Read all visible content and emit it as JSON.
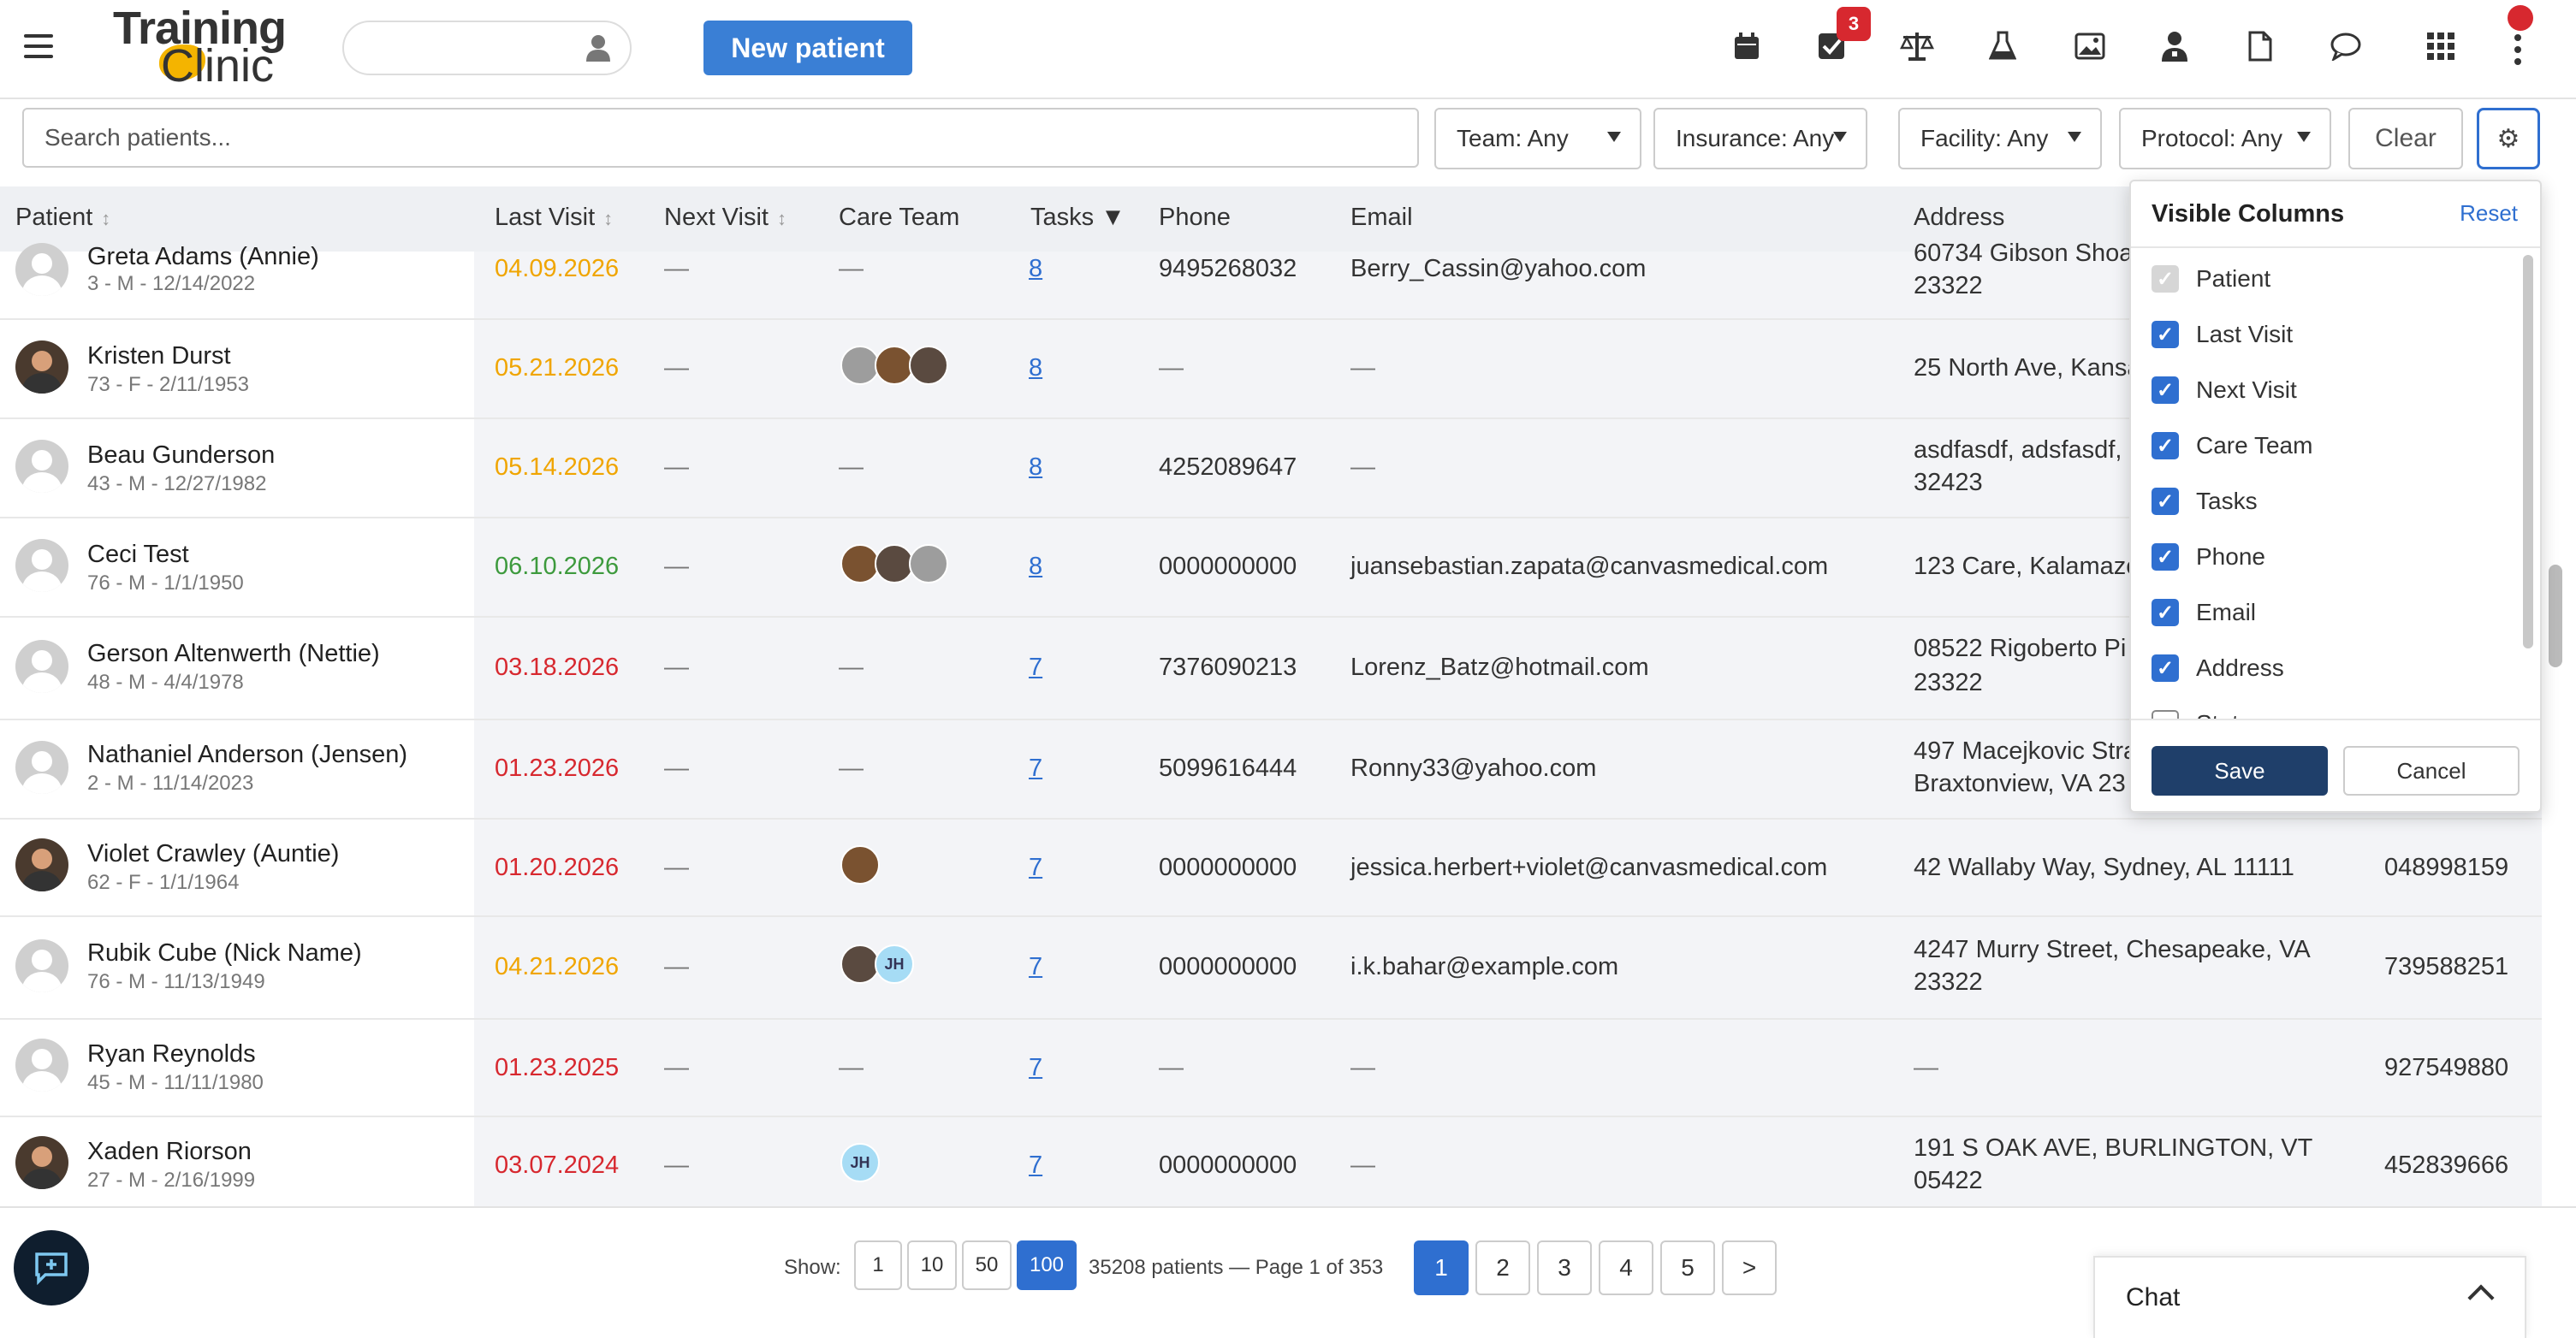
{
  "header": {
    "logo_line1": "Training",
    "logo_line2": "Clinic",
    "new_patient_label": "New patient",
    "tasks_badge": "3",
    "icons": [
      "calendar-icon",
      "tasks-icon",
      "scale-icon",
      "flask-icon",
      "image-icon",
      "doctor-icon",
      "document-icon",
      "chat-bubble-icon",
      "apps-grid-icon",
      "more-vertical-icon"
    ]
  },
  "filters": {
    "search_placeholder": "Search patients...",
    "team": "Team: Any",
    "insurance": "Insurance: Any",
    "facility": "Facility: Any",
    "protocol": "Protocol: Any",
    "clear": "Clear",
    "settings_icon": "⚙"
  },
  "table": {
    "columns": [
      "Patient",
      "Last Visit",
      "Next Visit",
      "Care Team",
      "Tasks ▼",
      "Phone",
      "Email",
      "Address"
    ],
    "rows": [
      {
        "name": "Greta Adams (Annie)",
        "meta": "3 - M - 12/14/2022",
        "last_visit": "04.09.2026",
        "lv_status": "orange",
        "next_visit": "—",
        "care_team_text": "—",
        "tasks": "8",
        "phone": "9495268032",
        "email": "Berry_Cassin@yahoo.com",
        "address": "60734 Gibson Shoa",
        "address2": "23322",
        "id": ""
      },
      {
        "name": "Kristen Durst",
        "meta": "73 - F - 2/11/1953",
        "last_visit": "05.21.2026",
        "lv_status": "orange",
        "next_visit": "—",
        "care_team_text": "",
        "tasks": "8",
        "phone": "—",
        "email": "—",
        "address": "25 North Ave, Kansa",
        "address2": "",
        "id": ""
      },
      {
        "name": "Beau Gunderson",
        "meta": "43 - M - 12/27/1982",
        "last_visit": "05.14.2026",
        "lv_status": "orange",
        "next_visit": "—",
        "care_team_text": "—",
        "tasks": "8",
        "phone": "4252089647",
        "email": "—",
        "address": "asdfasdf, adsfasdf,",
        "address2": "32423",
        "id": ""
      },
      {
        "name": "Ceci Test",
        "meta": "76 - M - 1/1/1950",
        "last_visit": "06.10.2026",
        "lv_status": "green",
        "next_visit": "—",
        "care_team_text": "",
        "tasks": "8",
        "phone": "0000000000",
        "email": "juansebastian.zapata@canvasmedical.com",
        "address": "123 Care, Kalamazo",
        "address2": "",
        "id": ""
      },
      {
        "name": "Gerson Altenwerth (Nettie)",
        "meta": "48 - M - 4/4/1978",
        "last_visit": "03.18.2026",
        "lv_status": "red",
        "next_visit": "—",
        "care_team_text": "—",
        "tasks": "7",
        "phone": "7376090213",
        "email": "Lorenz_Batz@hotmail.com",
        "address": "08522 Rigoberto Pi",
        "address2": "23322",
        "id": ""
      },
      {
        "name": "Nathaniel Anderson (Jensen)",
        "meta": "2 - M - 11/14/2023",
        "last_visit": "01.23.2026",
        "lv_status": "red",
        "next_visit": "—",
        "care_team_text": "—",
        "tasks": "7",
        "phone": "5099616444",
        "email": "Ronny33@yahoo.com",
        "address": "497 Macejkovic Stra",
        "address2": "Braxtonview, VA 23",
        "id": ""
      },
      {
        "name": "Violet Crawley (Auntie)",
        "meta": "62 - F - 1/1/1964",
        "last_visit": "01.20.2026",
        "lv_status": "red",
        "next_visit": "—",
        "care_team_text": "",
        "tasks": "7",
        "phone": "0000000000",
        "email": "jessica.herbert+violet@canvasmedical.com",
        "address": "42 Wallaby Way, Sydney, AL 11111",
        "address2": "",
        "id": "048998159"
      },
      {
        "name": "Rubik Cube (Nick Name)",
        "meta": "76 - M - 11/13/1949",
        "last_visit": "04.21.2026",
        "lv_status": "orange",
        "next_visit": "—",
        "care_team_text": "",
        "tasks": "7",
        "phone": "0000000000",
        "email": "i.k.bahar@example.com",
        "address": "4247 Murry Street, Chesapeake, VA",
        "address2": "23322",
        "id": "739588251"
      },
      {
        "name": "Ryan Reynolds",
        "meta": "45 - M - 11/11/1980",
        "last_visit": "01.23.2025",
        "lv_status": "red",
        "next_visit": "—",
        "care_team_text": "—",
        "tasks": "7",
        "phone": "—",
        "email": "—",
        "address": "—",
        "address2": "",
        "id": "927549880"
      },
      {
        "name": "Xaden Riorson",
        "meta": "27 - M - 2/16/1999",
        "last_visit": "03.07.2024",
        "lv_status": "red",
        "next_visit": "—",
        "care_team_text": "",
        "tasks": "7",
        "phone": "0000000000",
        "email": "—",
        "address": "191 S OAK AVE, BURLINGTON, VT",
        "address2": "05422",
        "id": "452839666"
      }
    ]
  },
  "column_panel": {
    "title": "Visible Columns",
    "reset": "Reset",
    "items": [
      {
        "label": "Patient",
        "state": "disabled"
      },
      {
        "label": "Last Visit",
        "state": "checked"
      },
      {
        "label": "Next Visit",
        "state": "checked"
      },
      {
        "label": "Care Team",
        "state": "checked"
      },
      {
        "label": "Tasks",
        "state": "checked"
      },
      {
        "label": "Phone",
        "state": "checked"
      },
      {
        "label": "Email",
        "state": "checked"
      },
      {
        "label": "Address",
        "state": "checked"
      },
      {
        "label": "Status",
        "state": "unchecked"
      }
    ],
    "save": "Save",
    "cancel": "Cancel"
  },
  "footer": {
    "show_label": "Show:",
    "page_sizes": [
      "1",
      "10",
      "50",
      "100"
    ],
    "active_size": "100",
    "info": "35208 patients — Page 1 of 353",
    "pages": [
      "1",
      "2",
      "3",
      "4",
      "5",
      ">"
    ],
    "active_page": "1",
    "chat_label": "Chat",
    "initials": "JH"
  },
  "colors": {
    "accent": "#2f6fd0",
    "orange": "#f0a500",
    "green": "#3d9a3d",
    "red": "#d7282f"
  }
}
